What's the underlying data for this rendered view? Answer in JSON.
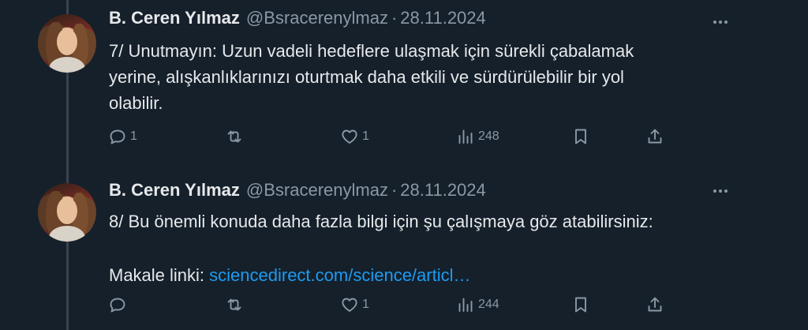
{
  "tweets": [
    {
      "author_name": "B. Ceren Yılmaz",
      "handle": "@Bsracerenylmaz",
      "separator": "·",
      "date": "28.11.2024",
      "lines": [
        "7/ Unutmayın: Uzun vadeli hedeflere ulaşmak için sürekli çabalamak",
        "yerine, alışkanlıklarınızı oturtmak daha etkili ve sürdürülebilir bir yol",
        "olabilir."
      ],
      "actions": {
        "reply_count": "1",
        "retweet_count": "",
        "like_count": "1",
        "view_count": "248"
      }
    },
    {
      "author_name": "B. Ceren Yılmaz",
      "handle": "@Bsracerenylmaz",
      "separator": "·",
      "date": "28.11.2024",
      "lines": [
        "8/ Bu önemli konuda daha fazla bilgi için şu çalışmaya göz atabilirsiniz:",
        ""
      ],
      "link_prefix": "Makale linki: ",
      "link_text": "sciencedirect.com/science/articl…",
      "actions": {
        "reply_count": "",
        "retweet_count": "",
        "like_count": "1",
        "view_count": "244"
      }
    }
  ],
  "icons": {
    "reply": "reply-icon",
    "retweet": "retweet-icon",
    "like": "heart-icon",
    "views": "views-icon",
    "bookmark": "bookmark-icon",
    "share": "share-icon",
    "more": "more-icon"
  },
  "colors": {
    "background": "#15202b",
    "text": "#e7e9ea",
    "secondary": "#8b98a5",
    "link": "#1d9bf0",
    "thread_line": "#38444d"
  }
}
